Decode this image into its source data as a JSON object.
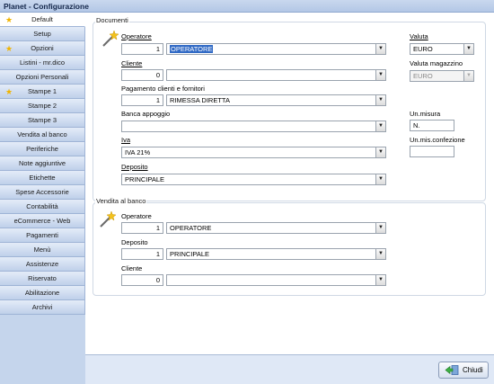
{
  "window": {
    "title": "Planet - Configurazione"
  },
  "sidebar": {
    "items": [
      {
        "label": "Default",
        "star": true,
        "active": true
      },
      {
        "label": "Setup"
      },
      {
        "label": "Opzioni",
        "star": true
      },
      {
        "label": "Listini - mr.dico"
      },
      {
        "label": "Opzioni Personali"
      },
      {
        "label": "Stampe 1",
        "star": true
      },
      {
        "label": "Stampe 2"
      },
      {
        "label": "Stampe 3"
      },
      {
        "label": "Vendita al banco"
      },
      {
        "label": "Periferiche"
      },
      {
        "label": "Note aggiuntive"
      },
      {
        "label": "Etichette"
      },
      {
        "label": "Spese Accessorie"
      },
      {
        "label": "Contabilità"
      },
      {
        "label": "eCommerce - Web"
      },
      {
        "label": "Pagamenti"
      },
      {
        "label": "Menù"
      },
      {
        "label": "Assistenze"
      },
      {
        "label": "Riservato"
      },
      {
        "label": "Abilitazione"
      },
      {
        "label": "Archivi"
      }
    ]
  },
  "documenti": {
    "title": "Documenti",
    "operatore": {
      "label": "Operatore",
      "code": "1",
      "value": "OPERATORE"
    },
    "cliente": {
      "label": "Cliente",
      "code": "0",
      "value": ""
    },
    "pagamento": {
      "label": "Pagamento clienti e fornitori",
      "code": "1",
      "value": "RIMESSA DIRETTA"
    },
    "banca": {
      "label": "Banca appoggio",
      "value": ""
    },
    "iva": {
      "label": "Iva",
      "value": "IVA 21%"
    },
    "deposito": {
      "label": "Deposito",
      "value": "PRINCIPALE"
    },
    "valuta": {
      "label": "Valuta",
      "value": "EURO"
    },
    "valuta_magazzino": {
      "label": "Valuta magazzino",
      "value": "EURO"
    },
    "um": {
      "label": "Un.misura",
      "value": "N."
    },
    "um_conf": {
      "label": "Un.mis.confezione",
      "value": ""
    }
  },
  "vendita": {
    "title": "Vendita al banco",
    "operatore": {
      "label": "Operatore",
      "code": "1",
      "value": "OPERATORE"
    },
    "deposito": {
      "label": "Deposito",
      "code": "1",
      "value": "PRINCIPALE"
    },
    "cliente": {
      "label": "Cliente",
      "code": "0",
      "value": ""
    }
  },
  "footer": {
    "close_label": "Chiudi"
  },
  "icons": {
    "dropdown": "chevron-down-icon",
    "wand": "magic-wand-icon",
    "star": "star-icon",
    "close": "close-door-icon"
  }
}
